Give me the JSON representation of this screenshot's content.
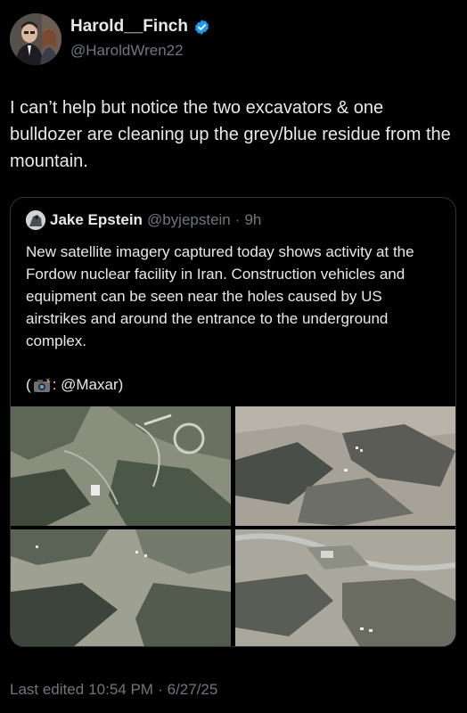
{
  "author": {
    "name": "Harold__Finch",
    "handle": "@HaroldWren22",
    "verified_icon": "verified-badge-icon"
  },
  "tweet": {
    "text": "I can’t help but notice the two excavators & one bulldozer are cleaning up the grey/blue residue from the mountain."
  },
  "quote": {
    "name": "Jake Epstein",
    "handle": "@byjepstein",
    "separator": "·",
    "time": "9h",
    "text": "New satellite imagery captured today shows activity at the Fordow nuclear facility in Iran. Construction vehicles and equipment can be seen near the holes caused by US airstrikes and around the entrance to the underground complex.",
    "credit_prefix": "(",
    "credit_suffix": ": @Maxar)",
    "credit_icon": "camera-flash-icon",
    "images_count": 4
  },
  "footer": {
    "label": "Last edited",
    "time": "10:54 PM",
    "separator": "·",
    "date": "6/27/25"
  },
  "colors": {
    "background": "#000000",
    "text": "#e7e9ea",
    "muted": "#71767b",
    "verified": "#1d9bf0",
    "border": "#2f3336"
  }
}
